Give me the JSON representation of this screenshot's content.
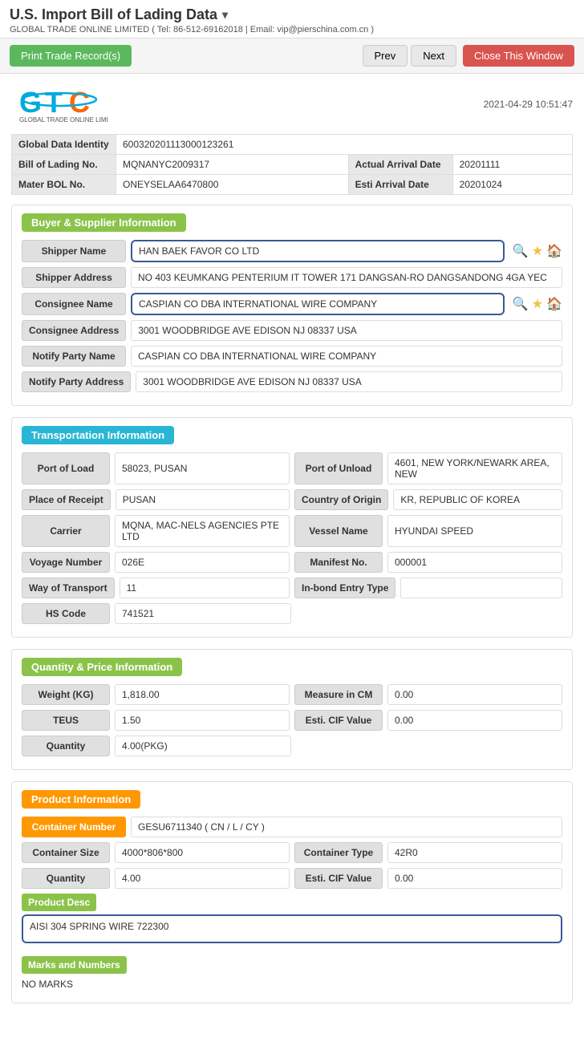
{
  "header": {
    "title": "U.S. Import Bill of Lading Data",
    "subtitle": "GLOBAL TRADE ONLINE LIMITED ( Tel: 86-512-69162018 | Email: vip@pierschina.com.cn )",
    "timestamp": "2021-04-29 10:51:47"
  },
  "toolbar": {
    "print_label": "Print Trade Record(s)",
    "prev_label": "Prev",
    "next_label": "Next",
    "close_label": "Close This Window"
  },
  "identity": {
    "global_data_label": "Global Data Identity",
    "global_data_value": "600320201113000123261",
    "bol_label": "Bill of Lading No.",
    "bol_value": "MQNANYC2009317",
    "actual_arrival_label": "Actual Arrival Date",
    "actual_arrival_value": "20201111",
    "master_bol_label": "Mater BOL No.",
    "master_bol_value": "ONEYSELAA6470800",
    "esti_arrival_label": "Esti Arrival Date",
    "esti_arrival_value": "20201024"
  },
  "buyer_supplier": {
    "section_title": "Buyer & Supplier Information",
    "shipper_name_label": "Shipper Name",
    "shipper_name_value": "HAN BAEK FAVOR CO LTD",
    "shipper_address_label": "Shipper Address",
    "shipper_address_value": "NO 403 KEUMKANG PENTERIUM IT TOWER 171 DANGSAN-RO DANGSANDONG 4GA YEC",
    "consignee_name_label": "Consignee Name",
    "consignee_name_value": "CASPIAN CO DBA INTERNATIONAL WIRE COMPANY",
    "consignee_address_label": "Consignee Address",
    "consignee_address_value": "3001 WOODBRIDGE AVE EDISON NJ 08337 USA",
    "notify_party_name_label": "Notify Party Name",
    "notify_party_name_value": "CASPIAN CO DBA INTERNATIONAL WIRE COMPANY",
    "notify_party_address_label": "Notify Party Address",
    "notify_party_address_value": "3001 WOODBRIDGE AVE EDISON NJ 08337 USA"
  },
  "transportation": {
    "section_title": "Transportation Information",
    "port_of_load_label": "Port of Load",
    "port_of_load_value": "58023, PUSAN",
    "port_of_unload_label": "Port of Unload",
    "port_of_unload_value": "4601, NEW YORK/NEWARK AREA, NEW",
    "place_of_receipt_label": "Place of Receipt",
    "place_of_receipt_value": "PUSAN",
    "country_of_origin_label": "Country of Origin",
    "country_of_origin_value": "KR, REPUBLIC OF KOREA",
    "carrier_label": "Carrier",
    "carrier_value": "MQNA, MAC-NELS AGENCIES PTE LTD",
    "vessel_name_label": "Vessel Name",
    "vessel_name_value": "HYUNDAI SPEED",
    "voyage_number_label": "Voyage Number",
    "voyage_number_value": "026E",
    "manifest_no_label": "Manifest No.",
    "manifest_no_value": "000001",
    "way_of_transport_label": "Way of Transport",
    "way_of_transport_value": "11",
    "in_bond_entry_label": "In-bond Entry Type",
    "in_bond_entry_value": "",
    "hs_code_label": "HS Code",
    "hs_code_value": "741521"
  },
  "quantity_price": {
    "section_title": "Quantity & Price Information",
    "weight_label": "Weight (KG)",
    "weight_value": "1,818.00",
    "measure_label": "Measure in CM",
    "measure_value": "0.00",
    "teus_label": "TEUS",
    "teus_value": "1.50",
    "esti_cif_label": "Esti. CIF Value",
    "esti_cif_value": "0.00",
    "quantity_label": "Quantity",
    "quantity_value": "4.00(PKG)"
  },
  "product": {
    "section_title": "Product Information",
    "container_number_label": "Container Number",
    "container_number_value": "GESU6711340 ( CN / L / CY )",
    "container_size_label": "Container Size",
    "container_size_value": "4000*806*800",
    "container_type_label": "Container Type",
    "container_type_value": "42R0",
    "quantity_label": "Quantity",
    "quantity_value": "4.00",
    "esti_cif_label": "Esti. CIF Value",
    "esti_cif_value": "0.00",
    "product_desc_label": "Product Desc",
    "product_desc_value": "AISI 304 SPRING WIRE 722300",
    "marks_label": "Marks and Numbers",
    "marks_value": "NO MARKS"
  },
  "logo": {
    "company_name": "GLOBAL TRADE ONLINE LIMITED"
  }
}
